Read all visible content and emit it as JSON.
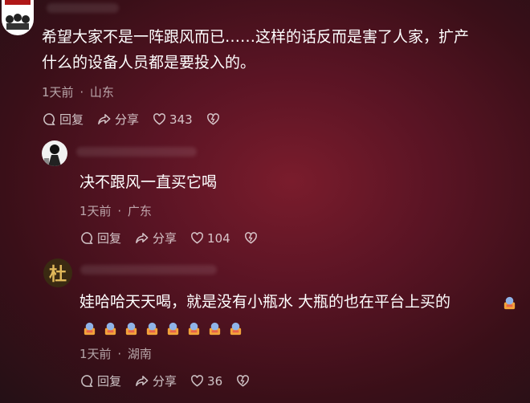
{
  "comments": [
    {
      "text_line1": "希望大家不是一阵跟风而已……这样的话反而是害了人家，扩产",
      "text_line2": "什么的设备人员都是要投入的。",
      "time": "1天前",
      "location": "山东",
      "reply_label": "回复",
      "share_label": "分享",
      "like_count": "343"
    },
    {
      "text": "决不跟风一直买它喝",
      "time": "1天前",
      "location": "广东",
      "reply_label": "回复",
      "share_label": "分享",
      "like_count": "104"
    },
    {
      "text": "娃哈哈天天喝，就是没有小瓶水 大瓶的也在平台上买的",
      "avatar_text": "杜",
      "time": "1天前",
      "location": "湖南",
      "reply_label": "回复",
      "share_label": "分享",
      "like_count": "36"
    }
  ],
  "meta_separator": "·",
  "icons": [
    "reply-icon",
    "share-icon",
    "heart-icon",
    "dislike-icon",
    "emoji-icon"
  ],
  "colors": {
    "text": "#ffffff",
    "meta": "#c9a8ae",
    "background": "#5a1424"
  }
}
